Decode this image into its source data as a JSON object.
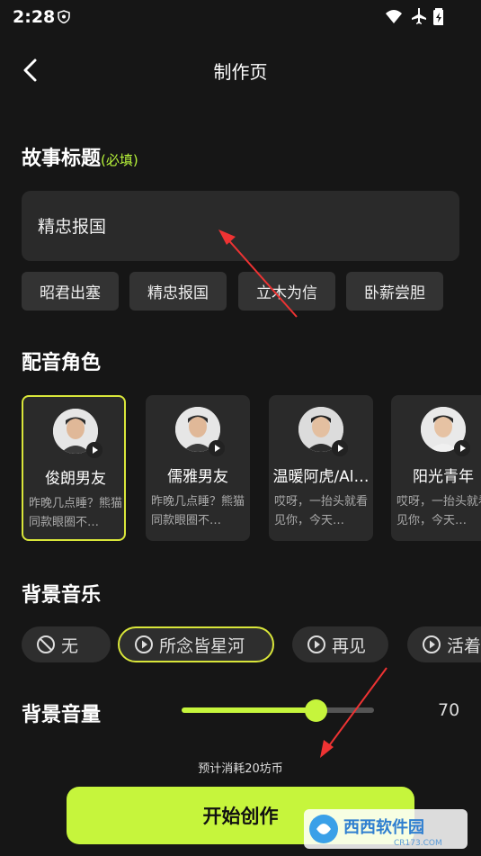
{
  "status_bar": {
    "time": "2:28"
  },
  "header": {
    "title": "制作页"
  },
  "story": {
    "section_title": "故事标题",
    "required_note": "(必填)",
    "input_value": "精忠报国",
    "chips": [
      "昭君出塞",
      "精忠报国",
      "立木为信",
      "卧薪尝胆"
    ]
  },
  "voices": {
    "section_title": "配音角色",
    "items": [
      {
        "name": "俊朗男友",
        "desc": "昨晚几点睡？熊猫同款眼圈不…",
        "selected": true
      },
      {
        "name": "儒雅男友",
        "desc": "昨晚几点睡？熊猫同款眼圈不…",
        "selected": false
      },
      {
        "name": "温暖阿虎/Al…",
        "desc": "哎呀，一抬头就看见你，今天…",
        "selected": false
      },
      {
        "name": "阳光青年",
        "desc": "哎呀，一抬头就看见你，今天…",
        "selected": false
      }
    ]
  },
  "music": {
    "section_title": "背景音乐",
    "items": [
      {
        "label": "无",
        "icon": "ban-icon"
      },
      {
        "label": "所念皆星河",
        "icon": "play-icon",
        "selected": true
      },
      {
        "label": "再见",
        "icon": "play-icon"
      },
      {
        "label": "活着",
        "icon": "play-icon"
      }
    ]
  },
  "volume": {
    "section_title": "背景音量",
    "value": "70",
    "level": 0.7
  },
  "footer": {
    "cost_text": "预计消耗20坊币",
    "start_label": "开始创作"
  },
  "watermark": {
    "text": "西西软件园",
    "sub": "CR173.COM"
  },
  "colors": {
    "accent": "#c6f53c",
    "selected_border": "#d9e63a",
    "background": "#161616"
  }
}
